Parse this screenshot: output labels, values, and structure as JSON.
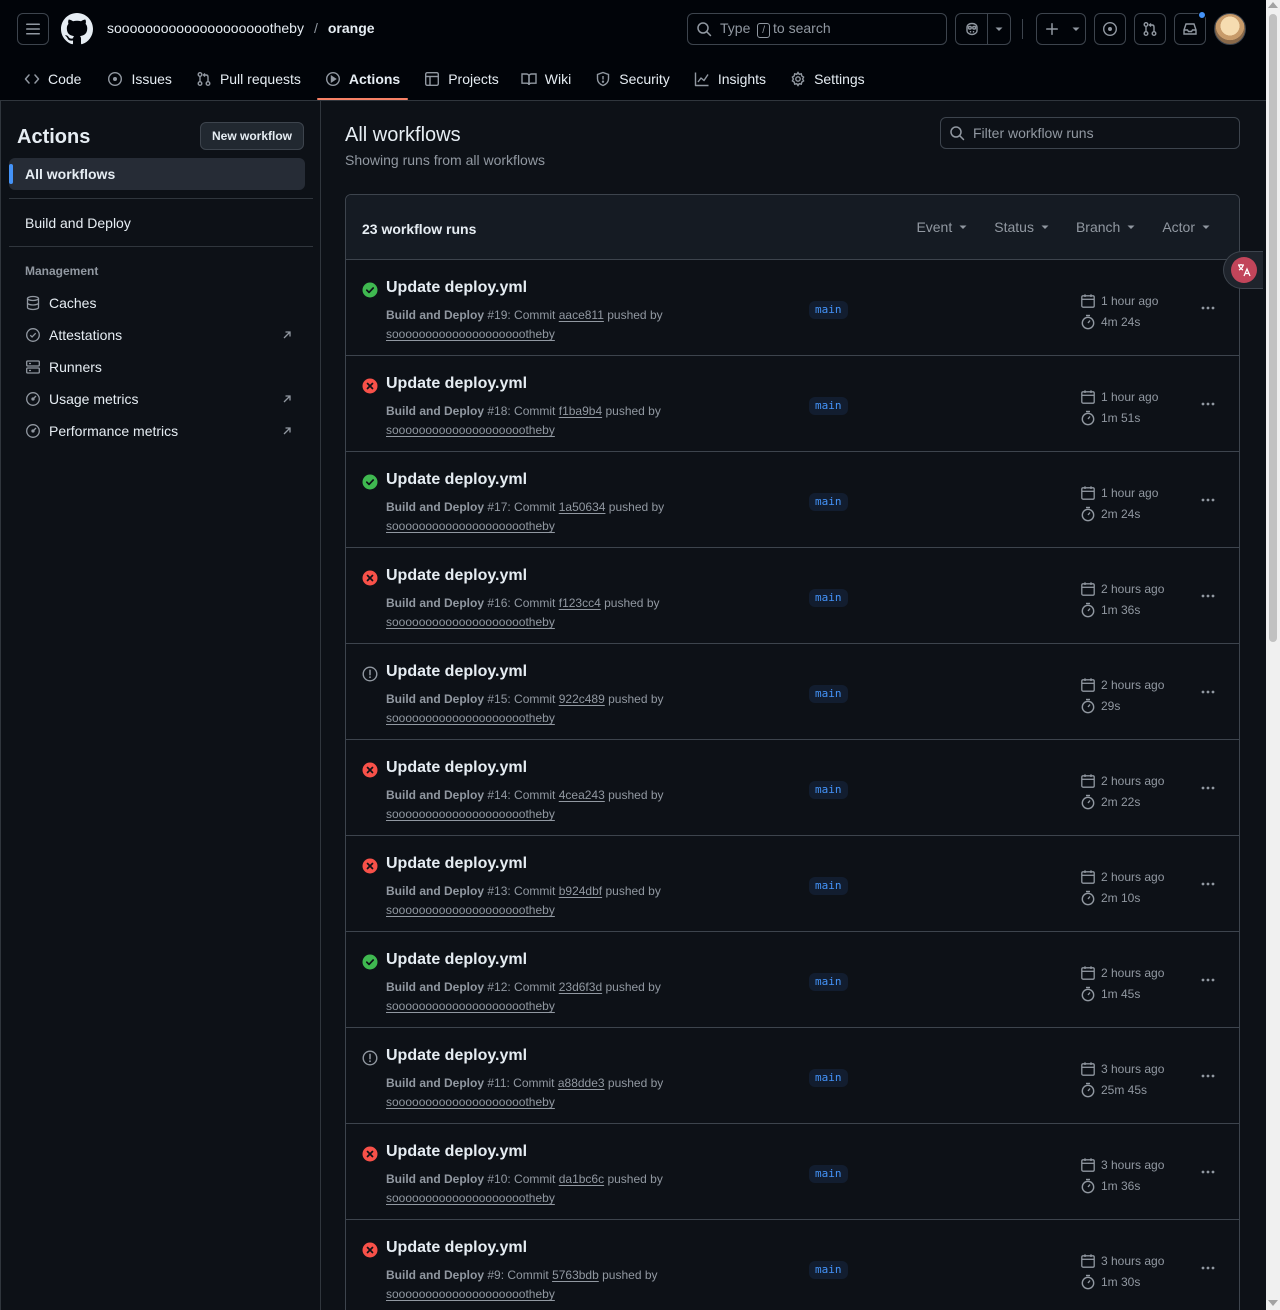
{
  "header": {
    "owner": "sooooooooooooooooooootheby",
    "separator": "/",
    "repo": "orange",
    "search": {
      "prefix": "Type",
      "key": "/",
      "suffix": "to search"
    }
  },
  "nav": {
    "tabs": [
      {
        "label": "Code",
        "icon": "code-icon"
      },
      {
        "label": "Issues",
        "icon": "issue-icon"
      },
      {
        "label": "Pull requests",
        "icon": "pull-request-icon"
      },
      {
        "label": "Actions",
        "icon": "play-icon",
        "active": true
      },
      {
        "label": "Projects",
        "icon": "table-icon"
      },
      {
        "label": "Wiki",
        "icon": "book-icon"
      },
      {
        "label": "Security",
        "icon": "shield-icon"
      },
      {
        "label": "Insights",
        "icon": "graph-icon"
      },
      {
        "label": "Settings",
        "icon": "gear-icon"
      }
    ]
  },
  "sidebar": {
    "title": "Actions",
    "new_workflow": "New workflow",
    "all_workflows": "All workflows",
    "workflow": "Build and Deploy",
    "section": "Management",
    "items": [
      {
        "label": "Caches",
        "icon": "database-icon",
        "external": false
      },
      {
        "label": "Attestations",
        "icon": "verified-icon",
        "external": true
      },
      {
        "label": "Runners",
        "icon": "server-icon",
        "external": false
      },
      {
        "label": "Usage metrics",
        "icon": "meter-icon",
        "external": true
      },
      {
        "label": "Performance metrics",
        "icon": "meter-icon",
        "external": true
      }
    ]
  },
  "main": {
    "title": "All workflows",
    "subtitle": "Showing runs from all workflows",
    "filter_placeholder": "Filter workflow runs",
    "count": "23 workflow runs",
    "filters": [
      "Event",
      "Status",
      "Branch",
      "Actor"
    ]
  },
  "colors": {
    "success": "#3fb950",
    "failure": "#f85149",
    "cancelled": "#9198a1",
    "accent": "#4493f8"
  },
  "runs": [
    {
      "status": "success",
      "title": "Update deploy.yml",
      "workflow": "Build and Deploy",
      "run": "#19",
      "commit_label": ": Commit",
      "sha": "aace811",
      "pushed": "pushed by",
      "actor": "sooooooooooooooooooootheby",
      "branch": "main",
      "when": "1 hour ago",
      "duration": "4m 24s"
    },
    {
      "status": "failure",
      "title": "Update deploy.yml",
      "workflow": "Build and Deploy",
      "run": "#18",
      "commit_label": ": Commit",
      "sha": "f1ba9b4",
      "pushed": "pushed by",
      "actor": "sooooooooooooooooooootheby",
      "branch": "main",
      "when": "1 hour ago",
      "duration": "1m 51s"
    },
    {
      "status": "success",
      "title": "Update deploy.yml",
      "workflow": "Build and Deploy",
      "run": "#17",
      "commit_label": ": Commit",
      "sha": "1a50634",
      "pushed": "pushed by",
      "actor": "sooooooooooooooooooootheby",
      "branch": "main",
      "when": "1 hour ago",
      "duration": "2m 24s"
    },
    {
      "status": "failure",
      "title": "Update deploy.yml",
      "workflow": "Build and Deploy",
      "run": "#16",
      "commit_label": ": Commit",
      "sha": "f123cc4",
      "pushed": "pushed by",
      "actor": "sooooooooooooooooooootheby",
      "branch": "main",
      "when": "2 hours ago",
      "duration": "1m 36s"
    },
    {
      "status": "cancelled",
      "title": "Update deploy.yml",
      "workflow": "Build and Deploy",
      "run": "#15",
      "commit_label": ": Commit",
      "sha": "922c489",
      "pushed": "pushed by",
      "actor": "sooooooooooooooooooootheby",
      "branch": "main",
      "when": "2 hours ago",
      "duration": "29s"
    },
    {
      "status": "failure",
      "title": "Update deploy.yml",
      "workflow": "Build and Deploy",
      "run": "#14",
      "commit_label": ": Commit",
      "sha": "4cea243",
      "pushed": "pushed by",
      "actor": "sooooooooooooooooooootheby",
      "branch": "main",
      "when": "2 hours ago",
      "duration": "2m 22s"
    },
    {
      "status": "failure",
      "title": "Update deploy.yml",
      "workflow": "Build and Deploy",
      "run": "#13",
      "commit_label": ": Commit",
      "sha": "b924dbf",
      "pushed": "pushed by",
      "actor": "sooooooooooooooooooootheby",
      "branch": "main",
      "when": "2 hours ago",
      "duration": "2m 10s"
    },
    {
      "status": "success",
      "title": "Update deploy.yml",
      "workflow": "Build and Deploy",
      "run": "#12",
      "commit_label": ": Commit",
      "sha": "23d6f3d",
      "pushed": "pushed by",
      "actor": "sooooooooooooooooooootheby",
      "branch": "main",
      "when": "2 hours ago",
      "duration": "1m 45s"
    },
    {
      "status": "cancelled",
      "title": "Update deploy.yml",
      "workflow": "Build and Deploy",
      "run": "#11",
      "commit_label": ": Commit",
      "sha": "a88dde3",
      "pushed": "pushed by",
      "actor": "sooooooooooooooooooootheby",
      "branch": "main",
      "when": "3 hours ago",
      "duration": "25m 45s"
    },
    {
      "status": "failure",
      "title": "Update deploy.yml",
      "workflow": "Build and Deploy",
      "run": "#10",
      "commit_label": ": Commit",
      "sha": "da1bc6c",
      "pushed": "pushed by",
      "actor": "sooooooooooooooooooootheby",
      "branch": "main",
      "when": "3 hours ago",
      "duration": "1m 36s"
    },
    {
      "status": "failure",
      "title": "Update deploy.yml",
      "workflow": "Build and Deploy",
      "run": "#9",
      "commit_label": ": Commit",
      "sha": "5763bdb",
      "pushed": "pushed by",
      "actor": "sooooooooooooooooooootheby",
      "branch": "main",
      "when": "3 hours ago",
      "duration": "1m 30s"
    }
  ]
}
